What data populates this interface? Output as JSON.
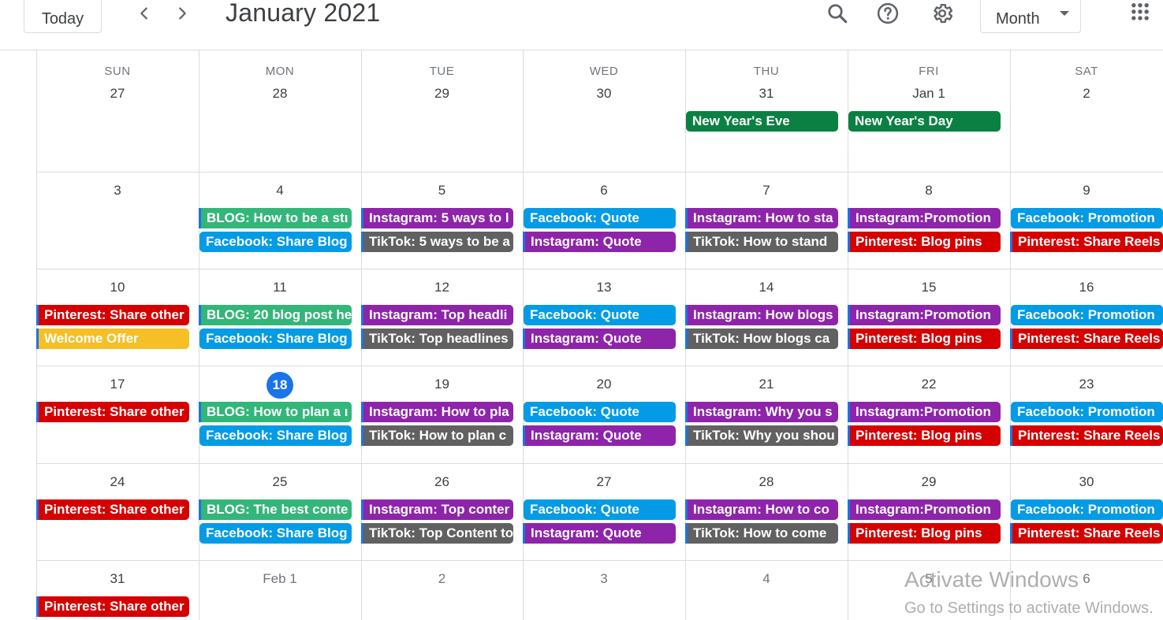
{
  "header": {
    "today_label": "Today",
    "title": "January 2021",
    "view_label": "Month",
    "icons": [
      "chevron-left-icon",
      "chevron-right-icon",
      "search-icon",
      "help-icon",
      "settings-icon",
      "caret-down-icon",
      "apps-grid-icon"
    ]
  },
  "colors": {
    "green": "#0b8043",
    "teal": "#33b679",
    "blue": "#039be5",
    "purple": "#8e24aa",
    "graphite": "#616161",
    "red": "#d50000",
    "yellow": "#f6bf26",
    "today": "#1a73e8"
  },
  "weekdays": [
    "SUN",
    "MON",
    "TUE",
    "WED",
    "THU",
    "FRI",
    "SAT"
  ],
  "weeks": [
    {
      "days": [
        {
          "label": "27",
          "muted": false,
          "events": []
        },
        {
          "label": "28",
          "muted": false,
          "events": []
        },
        {
          "label": "29",
          "muted": false,
          "events": []
        },
        {
          "label": "30",
          "muted": false,
          "events": []
        },
        {
          "label": "31",
          "muted": false,
          "events": [
            {
              "text": "New Year's Eve",
              "color": "green",
              "cont": false
            }
          ]
        },
        {
          "label": "Jan 1",
          "muted": false,
          "events": [
            {
              "text": "New Year's Day",
              "color": "green",
              "cont": false
            }
          ]
        },
        {
          "label": "2",
          "muted": false,
          "events": []
        }
      ]
    },
    {
      "days": [
        {
          "label": "3",
          "muted": false,
          "events": []
        },
        {
          "label": "4",
          "muted": false,
          "events": [
            {
              "text": "BLOG: How to be a stı",
              "color": "teal",
              "cont": true
            },
            {
              "text": "Facebook: Share Blog",
              "color": "blue",
              "cont": false
            }
          ]
        },
        {
          "label": "5",
          "muted": false,
          "events": [
            {
              "text": "Instagram: 5 ways to l",
              "color": "purple",
              "cont": true
            },
            {
              "text": "TikTok: 5 ways to be a",
              "color": "graphite",
              "cont": true
            }
          ]
        },
        {
          "label": "6",
          "muted": false,
          "events": [
            {
              "text": "Facebook: Quote",
              "color": "blue",
              "cont": false
            },
            {
              "text": "Instagram: Quote",
              "color": "purple",
              "cont": true
            }
          ]
        },
        {
          "label": "7",
          "muted": false,
          "events": [
            {
              "text": "Instagram: How to sta",
              "color": "purple",
              "cont": true
            },
            {
              "text": "TikTok: How to stand",
              "color": "graphite",
              "cont": true
            }
          ]
        },
        {
          "label": "8",
          "muted": false,
          "events": [
            {
              "text": "Instagram:Promotion",
              "color": "purple",
              "cont": true
            },
            {
              "text": "Pinterest: Blog pins",
              "color": "red",
              "cont": true
            }
          ]
        },
        {
          "label": "9",
          "muted": false,
          "events": [
            {
              "text": "Facebook: Promotion",
              "color": "blue",
              "cont": false
            },
            {
              "text": "Pinterest: Share Reels",
              "color": "red",
              "cont": true
            }
          ]
        }
      ]
    },
    {
      "days": [
        {
          "label": "10",
          "muted": false,
          "events": [
            {
              "text": "Pinterest: Share other",
              "color": "red",
              "cont": true
            },
            {
              "text": "Welcome Offer",
              "color": "yellow",
              "cont": true
            }
          ]
        },
        {
          "label": "11",
          "muted": false,
          "events": [
            {
              "text": "BLOG: 20 blog post he",
              "color": "teal",
              "cont": true
            },
            {
              "text": "Facebook: Share Blog",
              "color": "blue",
              "cont": false
            }
          ]
        },
        {
          "label": "12",
          "muted": false,
          "events": [
            {
              "text": "Instagram: Top headli",
              "color": "purple",
              "cont": true
            },
            {
              "text": "TikTok: Top headlines",
              "color": "graphite",
              "cont": true
            }
          ]
        },
        {
          "label": "13",
          "muted": false,
          "events": [
            {
              "text": "Facebook: Quote",
              "color": "blue",
              "cont": false
            },
            {
              "text": "Instagram: Quote",
              "color": "purple",
              "cont": true
            }
          ]
        },
        {
          "label": "14",
          "muted": false,
          "events": [
            {
              "text": "Instagram: How blogs",
              "color": "purple",
              "cont": true
            },
            {
              "text": "TikTok: How blogs ca",
              "color": "graphite",
              "cont": true
            }
          ]
        },
        {
          "label": "15",
          "muted": false,
          "events": [
            {
              "text": "Instagram:Promotion",
              "color": "purple",
              "cont": true
            },
            {
              "text": "Pinterest: Blog pins",
              "color": "red",
              "cont": true
            }
          ]
        },
        {
          "label": "16",
          "muted": false,
          "events": [
            {
              "text": "Facebook: Promotion",
              "color": "blue",
              "cont": false
            },
            {
              "text": "Pinterest: Share Reels",
              "color": "red",
              "cont": true
            }
          ]
        }
      ]
    },
    {
      "days": [
        {
          "label": "17",
          "muted": false,
          "events": [
            {
              "text": "Pinterest: Share other",
              "color": "red",
              "cont": true
            }
          ]
        },
        {
          "label": "18",
          "muted": false,
          "today": true,
          "events": [
            {
              "text": "BLOG: How to plan a ı",
              "color": "teal",
              "cont": true
            },
            {
              "text": "Facebook: Share Blog",
              "color": "blue",
              "cont": false
            }
          ]
        },
        {
          "label": "19",
          "muted": false,
          "events": [
            {
              "text": "Instagram: How to pla",
              "color": "purple",
              "cont": true
            },
            {
              "text": "TikTok: How to plan c",
              "color": "graphite",
              "cont": true
            }
          ]
        },
        {
          "label": "20",
          "muted": false,
          "events": [
            {
              "text": "Facebook: Quote",
              "color": "blue",
              "cont": false
            },
            {
              "text": "Instagram: Quote",
              "color": "purple",
              "cont": true
            }
          ]
        },
        {
          "label": "21",
          "muted": false,
          "events": [
            {
              "text": "Instagram: Why you s",
              "color": "purple",
              "cont": true
            },
            {
              "text": "TikTok: Why you shou",
              "color": "graphite",
              "cont": true
            }
          ]
        },
        {
          "label": "22",
          "muted": false,
          "events": [
            {
              "text": "Instagram:Promotion",
              "color": "purple",
              "cont": true
            },
            {
              "text": "Pinterest: Blog pins",
              "color": "red",
              "cont": true
            }
          ]
        },
        {
          "label": "23",
          "muted": false,
          "events": [
            {
              "text": "Facebook: Promotion",
              "color": "blue",
              "cont": false
            },
            {
              "text": "Pinterest: Share Reels",
              "color": "red",
              "cont": true
            }
          ]
        }
      ]
    },
    {
      "days": [
        {
          "label": "24",
          "muted": false,
          "events": [
            {
              "text": "Pinterest: Share other",
              "color": "red",
              "cont": true
            }
          ]
        },
        {
          "label": "25",
          "muted": false,
          "events": [
            {
              "text": "BLOG: The best conte",
              "color": "teal",
              "cont": true
            },
            {
              "text": "Facebook: Share Blog",
              "color": "blue",
              "cont": false
            }
          ]
        },
        {
          "label": "26",
          "muted": false,
          "events": [
            {
              "text": "Instagram: Top conter",
              "color": "purple",
              "cont": true
            },
            {
              "text": "TikTok: Top Content to",
              "color": "graphite",
              "cont": true
            }
          ]
        },
        {
          "label": "27",
          "muted": false,
          "events": [
            {
              "text": "Facebook: Quote",
              "color": "blue",
              "cont": false
            },
            {
              "text": "Instagram: Quote",
              "color": "purple",
              "cont": true
            }
          ]
        },
        {
          "label": "28",
          "muted": false,
          "events": [
            {
              "text": "Instagram: How to co",
              "color": "purple",
              "cont": true
            },
            {
              "text": "TikTok: How to come",
              "color": "graphite",
              "cont": true
            }
          ]
        },
        {
          "label": "29",
          "muted": false,
          "events": [
            {
              "text": "Instagram:Promotion",
              "color": "purple",
              "cont": true
            },
            {
              "text": "Pinterest: Blog pins",
              "color": "red",
              "cont": true
            }
          ]
        },
        {
          "label": "30",
          "muted": false,
          "events": [
            {
              "text": "Facebook: Promotion",
              "color": "blue",
              "cont": false
            },
            {
              "text": "Pinterest: Share Reels",
              "color": "red",
              "cont": true
            }
          ]
        }
      ]
    },
    {
      "days": [
        {
          "label": "31",
          "muted": false,
          "events": [
            {
              "text": "Pinterest: Share other",
              "color": "red",
              "cont": true
            }
          ]
        },
        {
          "label": "Feb 1",
          "muted": true,
          "events": []
        },
        {
          "label": "2",
          "muted": true,
          "events": []
        },
        {
          "label": "3",
          "muted": true,
          "events": []
        },
        {
          "label": "4",
          "muted": true,
          "events": []
        },
        {
          "label": "5",
          "muted": true,
          "events": []
        },
        {
          "label": "6",
          "muted": true,
          "events": []
        }
      ]
    }
  ],
  "watermark": {
    "line1": "Activate Windows",
    "line2": "Go to Settings to activate Windows."
  }
}
